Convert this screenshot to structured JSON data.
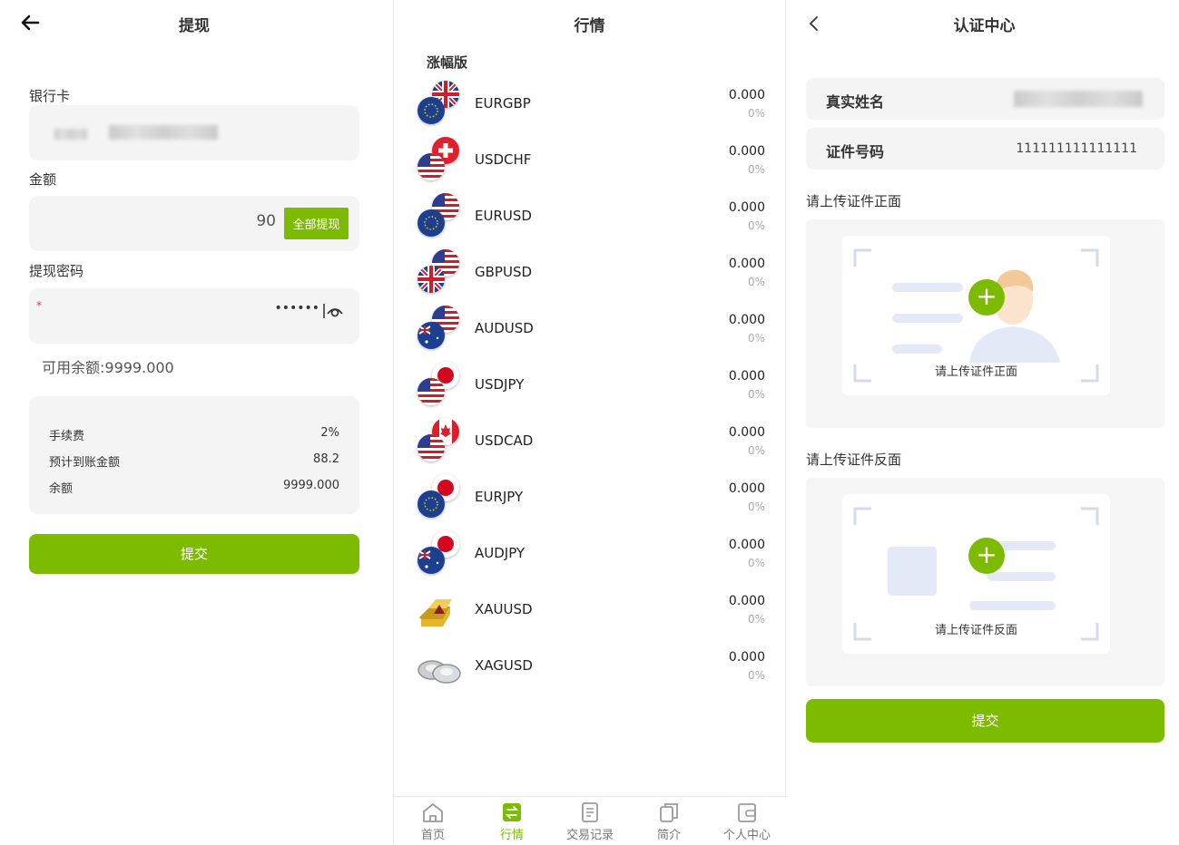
{
  "withdraw": {
    "title": "提现",
    "bank_label": "银行卡",
    "amount_label": "金额",
    "amount_value": "90",
    "withdraw_all": "全部提现",
    "password_label": "提现密码",
    "required_mark": "*",
    "password_mask": "••••••",
    "available": "可用余额:9999.000",
    "fees": [
      {
        "label": "手续费",
        "value": "2%"
      },
      {
        "label": "预计到账金额",
        "value": "88.2"
      },
      {
        "label": "余额",
        "value": "9999.000"
      }
    ],
    "submit": "提交"
  },
  "market": {
    "title": "行情",
    "section": "涨幅版",
    "rows": [
      {
        "symbol": "EURGBP",
        "price": "0.000",
        "change": "0%",
        "icon": "eur-gbp-flags-icon"
      },
      {
        "symbol": "USDCHF",
        "price": "0.000",
        "change": "0%",
        "icon": "usd-chf-flags-icon"
      },
      {
        "symbol": "EURUSD",
        "price": "0.000",
        "change": "0%",
        "icon": "eur-usd-flags-icon"
      },
      {
        "symbol": "GBPUSD",
        "price": "0.000",
        "change": "0%",
        "icon": "gbp-usd-flags-icon"
      },
      {
        "symbol": "AUDUSD",
        "price": "0.000",
        "change": "0%",
        "icon": "aud-usd-flags-icon"
      },
      {
        "symbol": "USDJPY",
        "price": "0.000",
        "change": "0%",
        "icon": "usd-jpy-flags-icon"
      },
      {
        "symbol": "USDCAD",
        "price": "0.000",
        "change": "0%",
        "icon": "usd-cad-flags-icon"
      },
      {
        "symbol": "EURJPY",
        "price": "0.000",
        "change": "0%",
        "icon": "eur-jpy-flags-icon"
      },
      {
        "symbol": "AUDJPY",
        "price": "0.000",
        "change": "0%",
        "icon": "aud-jpy-flags-icon"
      },
      {
        "symbol": "XAUUSD",
        "price": "0.000",
        "change": "0%",
        "icon": "gold-bars-icon"
      },
      {
        "symbol": "XAGUSD",
        "price": "0.000",
        "change": "0%",
        "icon": "silver-ingots-icon"
      }
    ],
    "tabs": [
      {
        "label": "首页",
        "icon": "home-icon",
        "active": false
      },
      {
        "label": "行情",
        "icon": "exchange-icon",
        "active": true
      },
      {
        "label": "交易记录",
        "icon": "records-icon",
        "active": false
      },
      {
        "label": "简介",
        "icon": "copy-icon",
        "active": false
      },
      {
        "label": "个人中心",
        "icon": "wallet-icon",
        "active": false
      }
    ]
  },
  "verify": {
    "title": "认证中心",
    "real_name_label": "真实姓名",
    "id_label": "证件号码",
    "id_value": "111111111111111",
    "front_label": "请上传证件正面",
    "front_caption": "请上传证件正面",
    "back_label": "请上传证件反面",
    "back_caption": "请上传证件反面",
    "submit": "提交"
  },
  "colors": {
    "accent": "#7dbb00",
    "field_bg": "#f4f4f4"
  }
}
